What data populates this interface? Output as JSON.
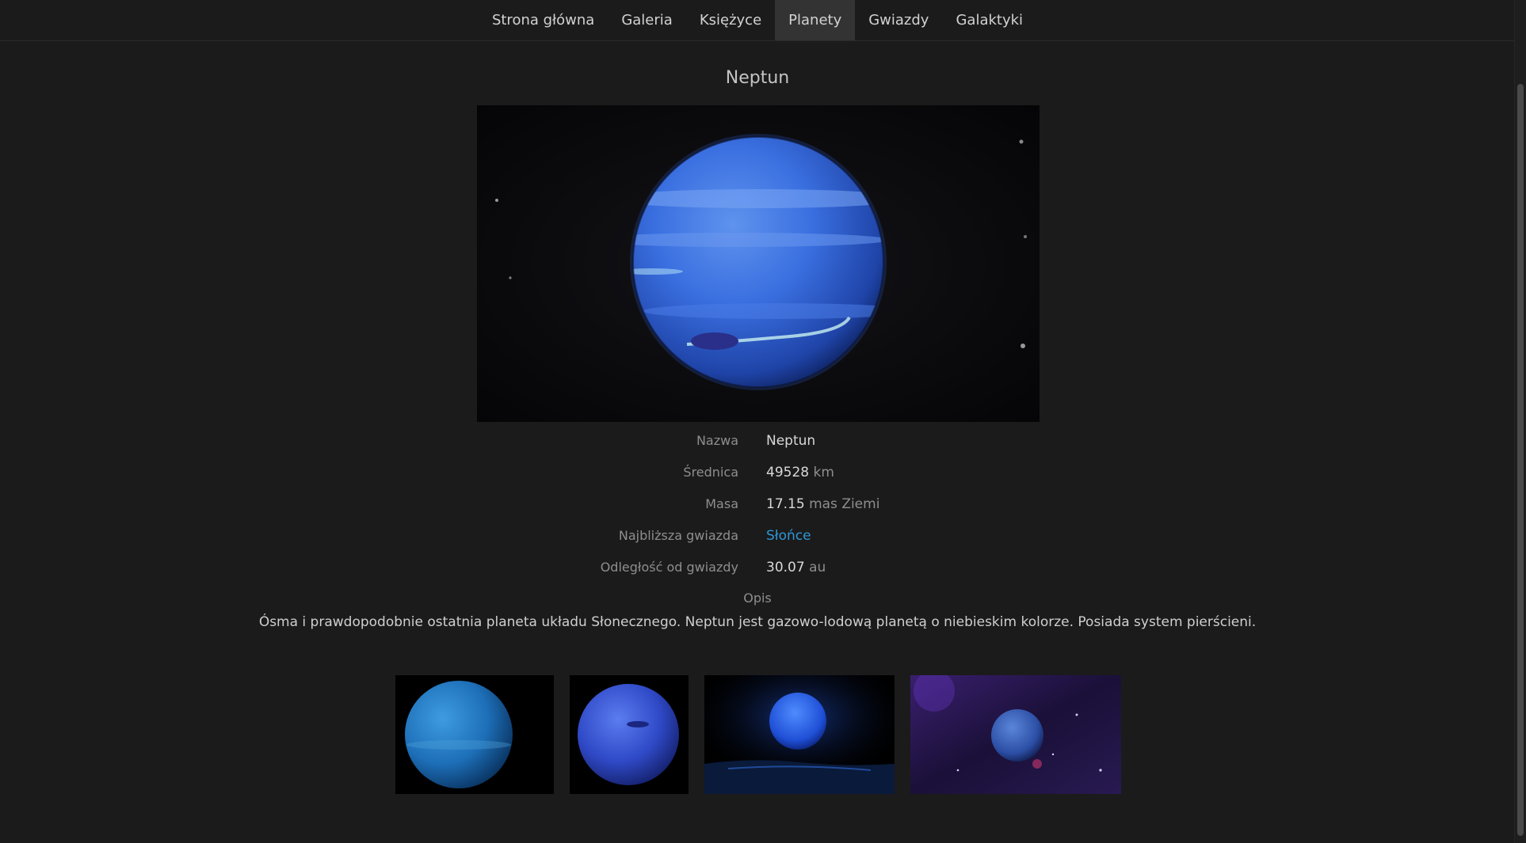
{
  "nav": {
    "items": [
      {
        "label": "Strona główna"
      },
      {
        "label": "Galeria"
      },
      {
        "label": "Księżyce"
      },
      {
        "label": "Planety",
        "active": true
      },
      {
        "label": "Gwiazdy"
      },
      {
        "label": "Galaktyki"
      }
    ]
  },
  "planet": {
    "title": "Neptun",
    "fields": {
      "name": {
        "label": "Nazwa",
        "value": "Neptun"
      },
      "diameter": {
        "label": "Średnica",
        "value": "49528",
        "unit": "km"
      },
      "mass": {
        "label": "Masa",
        "value": "17.15",
        "unit": "mas Ziemi"
      },
      "star": {
        "label": "Najbliższa gwiazda",
        "value": "Słońce"
      },
      "distance": {
        "label": "Odległość od gwiazdy",
        "value": "30.07",
        "unit": "au"
      }
    },
    "description_label": "Opis",
    "description": "Ósma i prawdopodobnie ostatnia planeta układu Słonecznego. Neptun jest gazowo-lodową planetą o niebieskim kolorze. Posiada system pierścieni."
  },
  "colors": {
    "background": "#1b1b1b",
    "nav_active": "#333333",
    "link": "#2e96d6",
    "planet_blue": "#3a73e0"
  },
  "gallery": {
    "images": [
      {
        "name": "neptune-teal-thumbnail"
      },
      {
        "name": "neptune-blue-thumbnail"
      },
      {
        "name": "neptune-over-ocean-thumbnail"
      },
      {
        "name": "neptune-nebula-thumbnail"
      }
    ]
  }
}
